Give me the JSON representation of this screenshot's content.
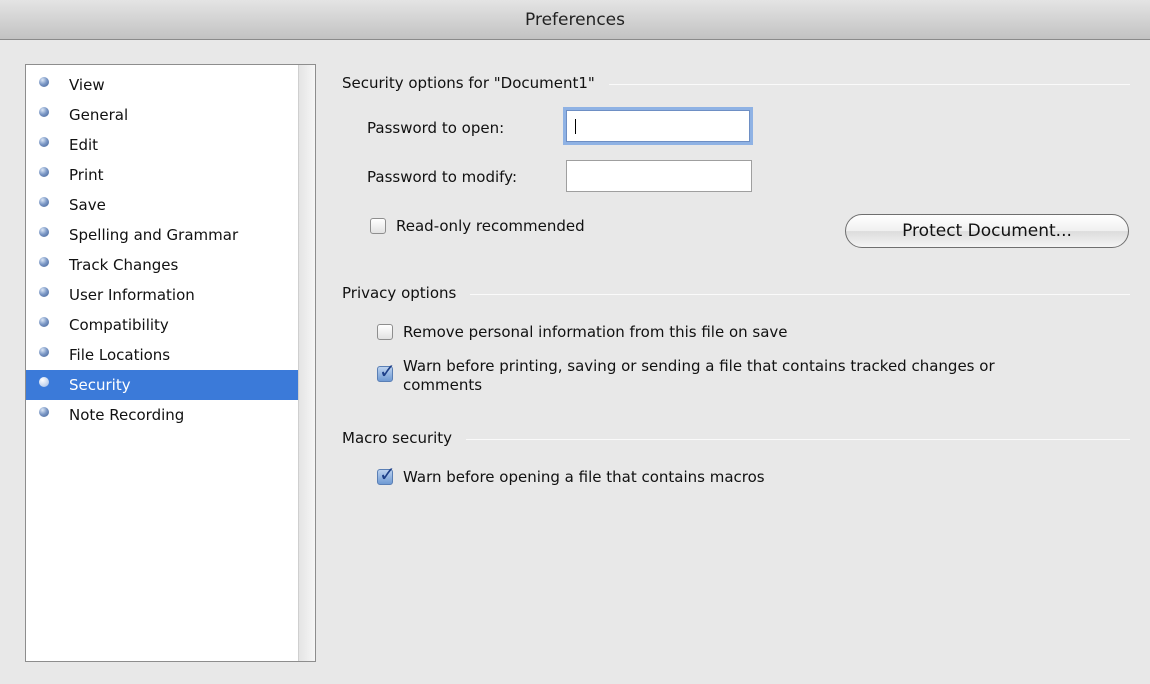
{
  "window": {
    "title": "Preferences"
  },
  "sidebar": {
    "items": [
      {
        "label": "View"
      },
      {
        "label": "General"
      },
      {
        "label": "Edit"
      },
      {
        "label": "Print"
      },
      {
        "label": "Save"
      },
      {
        "label": "Spelling and Grammar"
      },
      {
        "label": "Track Changes"
      },
      {
        "label": "User Information"
      },
      {
        "label": "Compatibility"
      },
      {
        "label": "File Locations"
      },
      {
        "label": "Security",
        "selected": true
      },
      {
        "label": "Note Recording"
      }
    ]
  },
  "security": {
    "heading": "Security options for \"Document1\"",
    "password_open_label": "Password to open:",
    "password_open_value": "",
    "password_modify_label": "Password to modify:",
    "password_modify_value": "",
    "readonly_label": "Read-only recommended",
    "readonly_checked": false,
    "protect_button": "Protect Document..."
  },
  "privacy": {
    "heading": "Privacy options",
    "remove_info_label": "Remove personal information from this file on save",
    "remove_info_checked": false,
    "warn_tracked_label_line1": "Warn before printing, saving or sending a file that contains tracked changes or",
    "warn_tracked_label_line2": "comments",
    "warn_tracked_checked": true
  },
  "macro": {
    "heading": "Macro security",
    "warn_macros_label": "Warn before opening a file that contains macros",
    "warn_macros_checked": true
  },
  "colors": {
    "selection": "#3b7ad9",
    "focus_ring": "#8fb2e4",
    "background": "#e8e8e8"
  }
}
